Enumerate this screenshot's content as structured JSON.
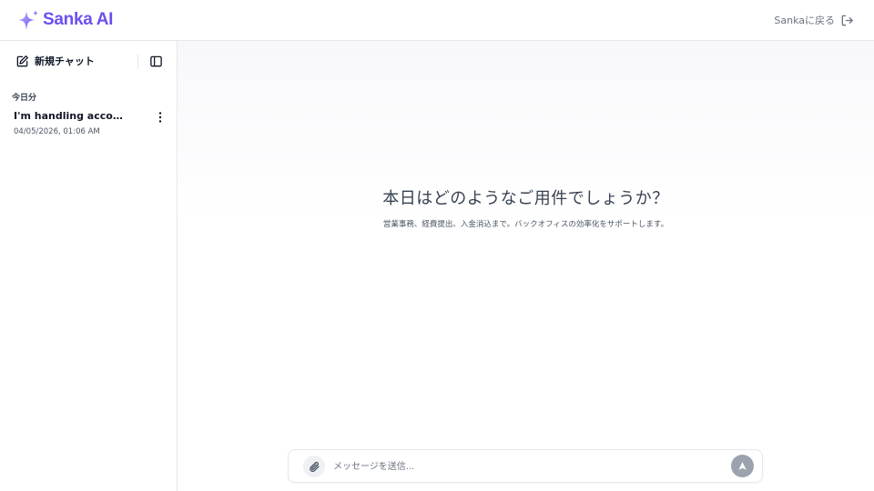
{
  "header": {
    "brand": "Sanka AI",
    "back_label": "Sankaに戻る",
    "brand_color": "#6d4ff0"
  },
  "sidebar": {
    "new_chat_label": "新規チャット",
    "section_label": "今日分",
    "chats": [
      {
        "title": "I'm handling accounti...",
        "timestamp": "04/05/2026, 01:06 AM"
      }
    ]
  },
  "main": {
    "title": "本日はどのようなご用件でしょうか？",
    "subtitle": "営業事務、経費提出、入金消込まで。バックオフィスの効率化をサポートします。"
  },
  "composer": {
    "value": "",
    "placeholder": "メッセージを送信..."
  },
  "icons": {
    "logo": "sparkle-logo-icon",
    "back": "logout-arrow-icon",
    "new_chat": "edit-icon",
    "sidebar_toggle": "sidebar-panel-icon",
    "more": "more-vertical-icon",
    "attach": "paperclip-icon",
    "send": "send-arrow-icon"
  }
}
